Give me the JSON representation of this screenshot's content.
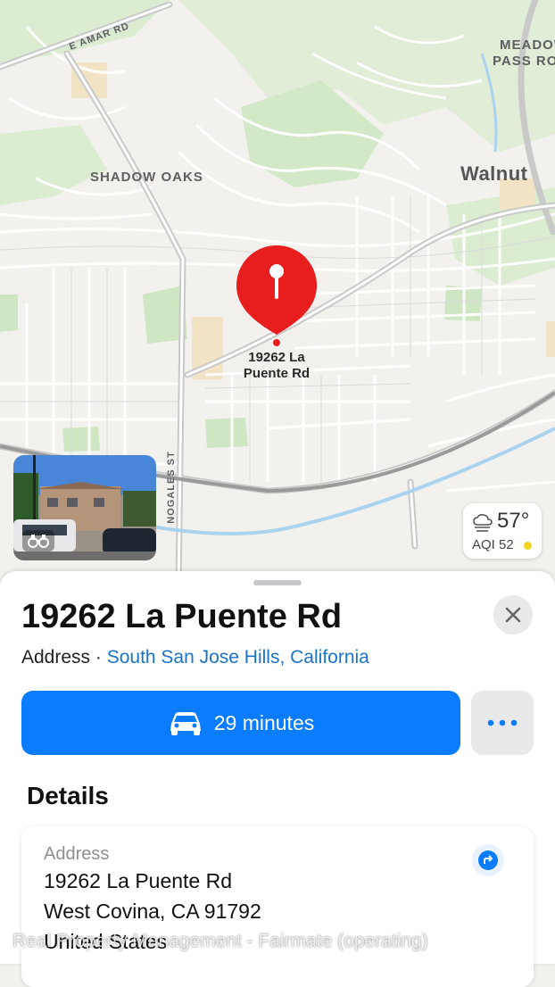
{
  "map": {
    "labels": {
      "e_amar_rd": "E AMAR RD",
      "meadow_pass_1": "MEADOW",
      "meadow_pass_2": "PASS ROA",
      "shadow_oaks": "SHADOW OAKS",
      "walnut": "Walnut",
      "nogales_st": "NOGALES ST"
    },
    "pin": {
      "line1": "19262 La",
      "line2": "Puente Rd",
      "color": "#e81d1d"
    }
  },
  "weather": {
    "temperature": "57°",
    "aqi": "AQI 52",
    "aqi_color": "#f5d21b"
  },
  "place": {
    "title": "19262 La Puente Rd",
    "category": "Address · ",
    "locality": "South San Jose Hills, California"
  },
  "actions": {
    "route_label": "29 minutes",
    "route_icon": "car-icon",
    "more_icon": "ellipsis-icon"
  },
  "details": {
    "heading": "Details",
    "address_label": "Address",
    "address_lines": [
      "19262 La Puente Rd",
      "West Covina, CA  91792",
      "United States"
    ]
  },
  "watermark": "Real Property Management - Fairmate (operating)",
  "colors": {
    "accent": "#0a7cff",
    "link": "#1a73c9",
    "map_bg": "#f2f1ed",
    "park": "#cfe6c2"
  }
}
